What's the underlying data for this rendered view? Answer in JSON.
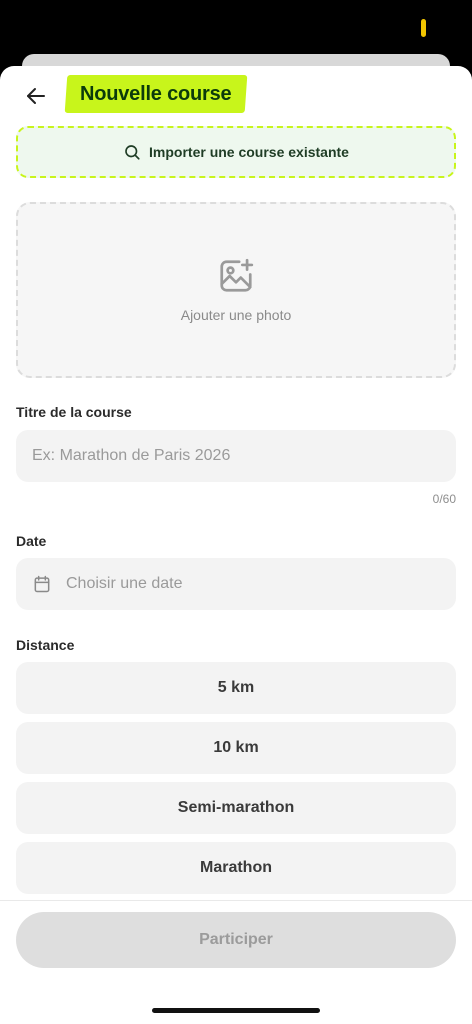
{
  "header": {
    "title": "Nouvelle course"
  },
  "import": {
    "label": "Importer une course existante"
  },
  "photo": {
    "label": "Ajouter une photo"
  },
  "course_title": {
    "label": "Titre de la course",
    "placeholder": "Ex: Marathon de Paris 2026",
    "value": "",
    "counter": "0/60"
  },
  "date": {
    "label": "Date",
    "placeholder": "Choisir une date"
  },
  "distance": {
    "label": "Distance",
    "options": [
      "5 km",
      "10 km",
      "Semi-marathon",
      "Marathon"
    ]
  },
  "submit": {
    "label": "Participer"
  },
  "colors": {
    "accent": "#c8f51b",
    "title_text": "#0b3b0b",
    "import_bg": "#eef8ee",
    "field_bg": "#f3f3f3",
    "disabled_button": "#dedede"
  },
  "icons": {
    "back": "arrow-left-icon",
    "import": "search-icon",
    "photo": "image-add-icon",
    "date": "calendar-icon"
  }
}
